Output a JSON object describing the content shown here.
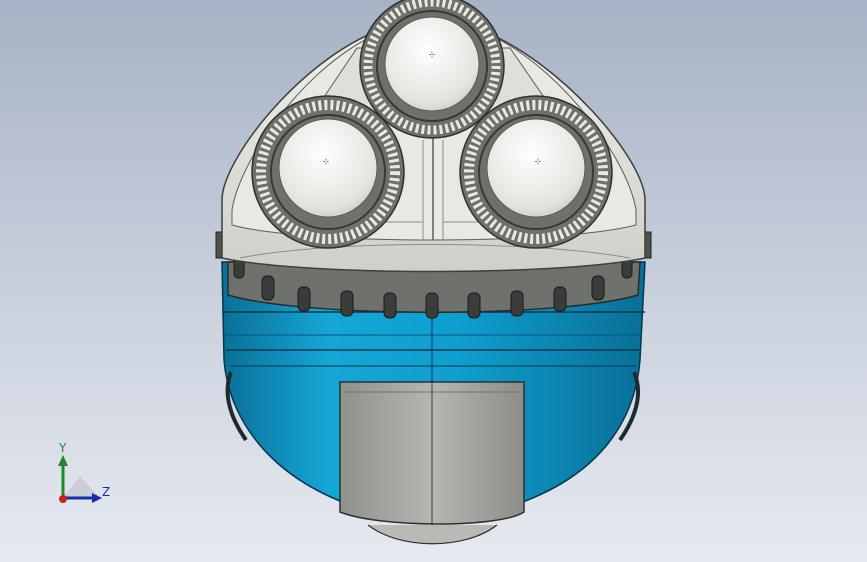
{
  "model_view": {
    "subject": "shaver-head-3d-model",
    "colors": {
      "background_top": "#a6b2c6",
      "background_bottom": "#e6e9f0",
      "body_blue": "#0e9fd0",
      "body_blue_dark": "#0a6f97",
      "head_grey": "#dcddd6",
      "ring_grey": "#6e706c",
      "guard_grey": "#a9a9a4"
    }
  },
  "triad": {
    "y_label": "Y",
    "z_label": "Z",
    "y_color": "#1d8a2a",
    "z_color": "#1a2aa8",
    "x_color": "#c8201c"
  }
}
